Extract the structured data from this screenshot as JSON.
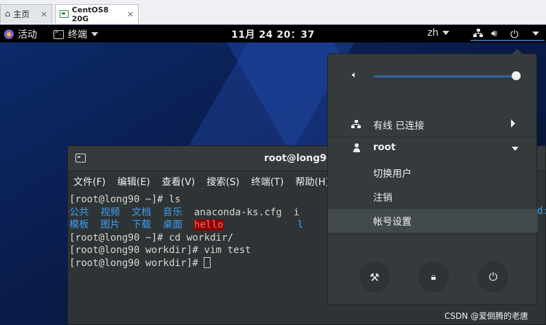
{
  "vmware_tabs": {
    "home_label": "主页",
    "vm_label": "CentOS8 20G",
    "close_glyph": "✕"
  },
  "topbar": {
    "activities": "活动",
    "app_menu": "终端",
    "clock": "11月 24  20：37",
    "language": "zh"
  },
  "terminal": {
    "title": "root@long90:",
    "menu": [
      "文件(F)",
      "编辑(E)",
      "查看(V)",
      "搜索(S)",
      "终端(T)",
      "帮助(H)"
    ],
    "lines": {
      "l1": "[root@long90 ~]# ls",
      "l2_dirs": "公共  视频  文档  音乐  ",
      "l2_file": "anaconda-ks.cfg  i",
      "l3_dirs": "模板  图片  下载  桌面  ",
      "l3_hello": "hello",
      "l3_tail": "l",
      "l4": "[root@long90 ~]# cd workdir/",
      "l5": "[root@long90 workdir]# vim test",
      "l6": "[root@long90 workdir]# "
    },
    "right_edge_char": "d:"
  },
  "system_menu": {
    "volume_level": 1.0,
    "wired": "有线 已连接",
    "user": "root",
    "switch_user": "切换用户",
    "logout": "注销",
    "account_settings": "帐号设置"
  },
  "watermark": "CSDN @爱倒腾的老唐",
  "colors": {
    "accent": "#3465a4",
    "directory": "#3f9ef1",
    "highlight_bg": "#8b0000"
  }
}
